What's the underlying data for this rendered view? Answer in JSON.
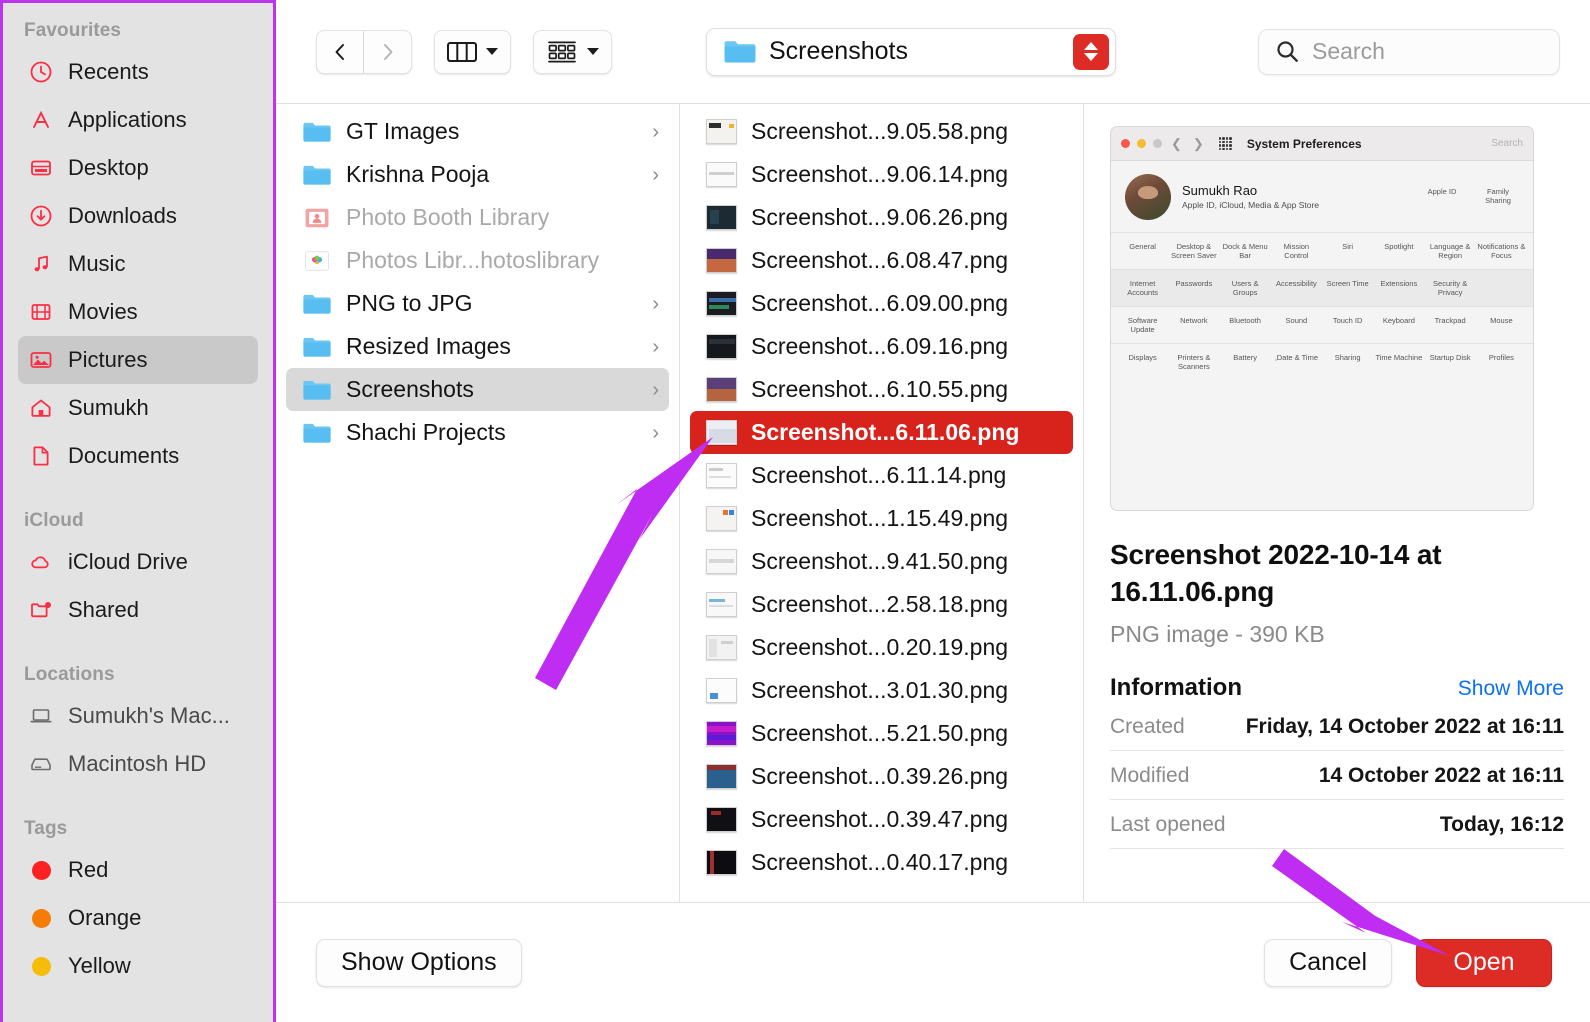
{
  "sidebar": {
    "sections": [
      {
        "title": "Favourites",
        "items": [
          {
            "label": "Recents",
            "icon": "clock-icon"
          },
          {
            "label": "Applications",
            "icon": "applications-icon"
          },
          {
            "label": "Desktop",
            "icon": "desktop-icon"
          },
          {
            "label": "Downloads",
            "icon": "download-icon"
          },
          {
            "label": "Music",
            "icon": "music-note-icon"
          },
          {
            "label": "Movies",
            "icon": "film-icon"
          },
          {
            "label": "Pictures",
            "icon": "photo-icon",
            "selected": true
          },
          {
            "label": "Sumukh",
            "icon": "home-icon"
          },
          {
            "label": "Documents",
            "icon": "document-icon"
          }
        ]
      },
      {
        "title": "iCloud",
        "items": [
          {
            "label": "iCloud Drive",
            "icon": "cloud-icon"
          },
          {
            "label": "Shared",
            "icon": "shared-folder-icon"
          }
        ]
      },
      {
        "title": "Locations",
        "items": [
          {
            "label": "Sumukh's Mac...",
            "icon": "laptop-icon"
          },
          {
            "label": "Macintosh HD",
            "icon": "hard-drive-icon"
          }
        ]
      },
      {
        "title": "Tags",
        "items": [
          {
            "label": "Red",
            "icon": "tag-dot-icon",
            "color": "#fc2222"
          },
          {
            "label": "Orange",
            "icon": "tag-dot-icon",
            "color": "#f57d07"
          },
          {
            "label": "Yellow",
            "icon": "tag-dot-icon",
            "color": "#f5bd08"
          }
        ]
      }
    ]
  },
  "toolbar": {
    "back_icon": "chevron-left-icon",
    "forward_icon": "chevron-right-icon",
    "view_icon": "column-view-icon",
    "view_chevron_icon": "chevron-down-icon",
    "group_icon": "group-by-icon",
    "group_chevron_icon": "chevron-down-icon",
    "path_folder_icon": "folder-icon",
    "path_label": "Screenshots",
    "path_stepper_icon": "up-down-stepper-icon",
    "search_icon": "search-icon",
    "search_value": "",
    "search_placeholder": "Search"
  },
  "folders": {
    "items": [
      {
        "name": "GT Images",
        "icon": "folder-icon",
        "arrow": true,
        "disabled": false
      },
      {
        "name": "Krishna Pooja",
        "icon": "folder-icon",
        "arrow": true,
        "disabled": false
      },
      {
        "name": "Photo Booth Library",
        "icon": "photo-booth-library-icon",
        "arrow": false,
        "disabled": true
      },
      {
        "name": "Photos Libr...hotoslibrary",
        "icon": "photos-library-icon",
        "arrow": false,
        "disabled": true
      },
      {
        "name": "PNG to JPG",
        "icon": "folder-icon",
        "arrow": true,
        "disabled": false
      },
      {
        "name": "Resized Images",
        "icon": "folder-icon",
        "arrow": true,
        "disabled": false
      },
      {
        "name": "Screenshots",
        "icon": "folder-icon",
        "arrow": true,
        "disabled": false,
        "selected": true
      },
      {
        "name": "Shachi Projects",
        "icon": "folder-icon",
        "arrow": true,
        "disabled": false
      }
    ]
  },
  "files": {
    "items": [
      {
        "name": "Screenshot...9.05.58.png",
        "thumb": "#f3f2ef"
      },
      {
        "name": "Screenshot...9.06.14.png",
        "thumb": "#fafafa"
      },
      {
        "name": "Screenshot...9.06.26.png",
        "thumb": "#1b2a33"
      },
      {
        "name": "Screenshot...6.08.47.png",
        "thumb": "#4a2a6e"
      },
      {
        "name": "Screenshot...6.09.00.png",
        "thumb": "#1b1b22"
      },
      {
        "name": "Screenshot...6.09.16.png",
        "thumb": "#15181c"
      },
      {
        "name": "Screenshot...6.10.55.png",
        "thumb": "#5a3f78"
      },
      {
        "name": "Screenshot...6.11.06.png",
        "thumb": "#eceef3",
        "selected": true
      },
      {
        "name": "Screenshot...6.11.14.png",
        "thumb": "#fbfbfb"
      },
      {
        "name": "Screenshot...1.15.49.png",
        "thumb": "#f4f3f1"
      },
      {
        "name": "Screenshot...9.41.50.png",
        "thumb": "#f7f7f7"
      },
      {
        "name": "Screenshot...2.58.18.png",
        "thumb": "#f8f8f8"
      },
      {
        "name": "Screenshot...0.20.19.png",
        "thumb": "#f2f2f2"
      },
      {
        "name": "Screenshot...3.01.30.png",
        "thumb": "#fcfcfc"
      },
      {
        "name": "Screenshot...5.21.50.png",
        "thumb": "#8a12c8"
      },
      {
        "name": "Screenshot...0.39.26.png",
        "thumb": "#2b5f8e"
      },
      {
        "name": "Screenshot...0.39.47.png",
        "thumb": "#101014"
      },
      {
        "name": "Screenshot...0.40.17.png",
        "thumb": "#0d0d11"
      }
    ]
  },
  "preview": {
    "title": "Screenshot 2022-10-14 at 16.11.06.png",
    "subtitle": "PNG image - 390 KB",
    "info_heading": "Information",
    "show_more": "Show More",
    "rows": [
      {
        "key": "Created",
        "value": "Friday, 14 October 2022 at 16:11"
      },
      {
        "key": "Modified",
        "value": "14 October 2022 at 16:11"
      },
      {
        "key": "Last opened",
        "value": "Today, 16:12"
      }
    ],
    "thumbnail": {
      "window_title": "System Preferences",
      "search_placeholder": "Search",
      "account_name": "Sumukh Rao",
      "account_subtitle": "Apple ID, iCloud, Media & App Store",
      "account_items": [
        {
          "label": "Apple ID",
          "color": "#6c6c6c"
        },
        {
          "label": "Family Sharing",
          "color": "#3e9ff0"
        }
      ],
      "row1": [
        {
          "label": "General",
          "color": "#e6d9a8"
        },
        {
          "label": "Desktop & Screen Saver",
          "color": "#4ec3f0"
        },
        {
          "label": "Dock & Menu Bar",
          "color": "#1b1b1b"
        },
        {
          "label": "Mission Control",
          "color": "#d9d9d9"
        },
        {
          "label": "Siri",
          "color": "#b43fb4"
        },
        {
          "label": "Spotlight",
          "color": "#cfcfcf"
        },
        {
          "label": "Language & Region",
          "color": "#2e82d8"
        },
        {
          "label": "Notifications & Focus",
          "color": "#d6d6d6"
        }
      ],
      "row2": [
        {
          "label": "Internet Accounts",
          "color": "#2e8df0"
        },
        {
          "label": "Passwords",
          "color": "#b9b9b9"
        },
        {
          "label": "Users & Groups",
          "color": "#8c8c8c"
        },
        {
          "label": "Accessibility",
          "color": "#2e8df0"
        },
        {
          "label": "Screen Time",
          "color": "#9b86d6"
        },
        {
          "label": "Extensions",
          "color": "#c3c3c3"
        },
        {
          "label": "Security & Privacy",
          "color": "#6e6e6e"
        }
      ],
      "row3": [
        {
          "label": "Software Update",
          "color": "#4a4a4a"
        },
        {
          "label": "Network",
          "color": "#2f7fc4"
        },
        {
          "label": "Bluetooth",
          "color": "#1484f5"
        },
        {
          "label": "Sound",
          "color": "#8c8c8c"
        },
        {
          "label": "Touch ID",
          "color": "#e3527f"
        },
        {
          "label": "Keyboard",
          "color": "#d2d2d2"
        },
        {
          "label": "Trackpad",
          "color": "#c6c6c6"
        },
        {
          "label": "Mouse",
          "color": "#e2e2e2"
        }
      ],
      "row4": [
        {
          "label": "Displays",
          "color": "#2eb4f0"
        },
        {
          "label": "Printers & Scanners",
          "color": "#9a9a9a"
        },
        {
          "label": "Battery",
          "color": "#2bd32b"
        },
        {
          "label": "Date & Time",
          "color": "#f2f2f2"
        },
        {
          "label": "Sharing",
          "color": "#5ec3f2"
        },
        {
          "label": "Time Machine",
          "color": "#0d5448"
        },
        {
          "label": "Startup Disk",
          "color": "#b4b8bc"
        },
        {
          "label": "Profiles",
          "color": "#a8a8a8"
        }
      ]
    }
  },
  "footer": {
    "show_options": "Show Options",
    "cancel": "Cancel",
    "open": "Open"
  },
  "annotations": {
    "arrow_color": "#b935f0",
    "arrows": [
      {
        "name": "arrow-to-selected-file"
      },
      {
        "name": "arrow-to-open-button"
      }
    ]
  },
  "colors": {
    "selection_red": "#d8231d",
    "primary_red": "#dd2b25",
    "sidebar_bg": "#e3e3e3",
    "link_blue": "#0a72f0",
    "annotation_purple": "#b935f0"
  }
}
